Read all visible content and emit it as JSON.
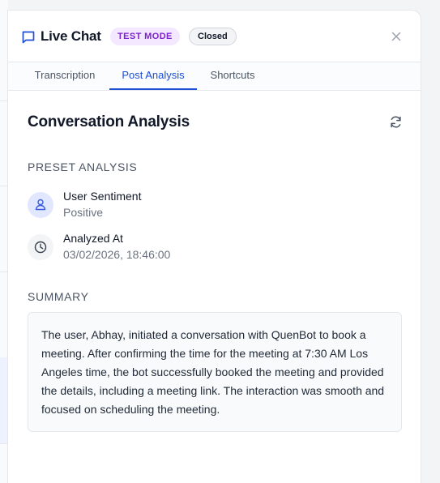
{
  "header": {
    "title": "Live Chat",
    "badge_test": "TEST MODE",
    "badge_status": "Closed",
    "chat_icon": "chat-bubble-icon",
    "close_icon": "close-icon"
  },
  "tabs": [
    {
      "label": "Transcription",
      "active": false
    },
    {
      "label": "Post Analysis",
      "active": true
    },
    {
      "label": "Shortcuts",
      "active": false
    }
  ],
  "analysis": {
    "title": "Conversation Analysis",
    "refresh_icon": "refresh-icon",
    "preset_heading": "PRESET ANALYSIS",
    "items": [
      {
        "label": "User Sentiment",
        "value": "Positive",
        "icon": "user-icon"
      },
      {
        "label": "Analyzed At",
        "value": "03/02/2026, 18:46:00",
        "icon": "clock-icon"
      }
    ],
    "summary_heading": "SUMMARY",
    "summary_text": "The user, Abhay, initiated a conversation with QuenBot to book a meeting. After confirming the time for the meeting at 7:30 AM Los Angeles time, the bot successfully booked the meeting and provided the details, including a meeting link. The interaction was smooth and focused on scheduling the meeting."
  },
  "colors": {
    "accent": "#1d4ed8",
    "test_badge_bg": "#f3e8ff",
    "test_badge_text": "#7e22ce"
  }
}
